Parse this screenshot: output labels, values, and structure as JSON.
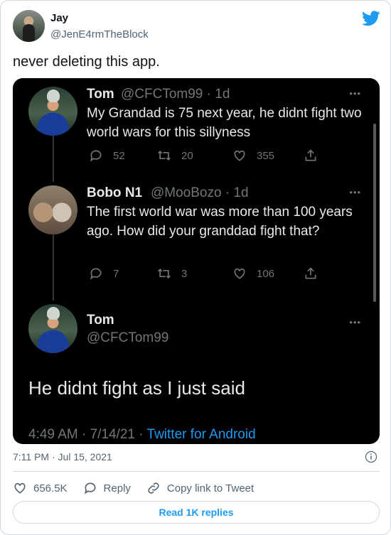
{
  "author": {
    "name": "Jay",
    "handle": "@JenE4rmTheBlock"
  },
  "tweet": {
    "text": "never deleting this app.",
    "timestamp": "7:11 PM · Jul 15, 2021",
    "likes": "656.5K",
    "reply_label": "Reply",
    "copy_link_label": "Copy link to Tweet",
    "read_replies_label": "Read 1K replies"
  },
  "screenshot": {
    "tweets": [
      {
        "name": "Tom",
        "handle": "@CFCTom99",
        "time": "· 1d",
        "text": "My Grandad is 75 next year,  he didnt fight two world wars for this sillyness",
        "replies": "52",
        "retweets": "20",
        "likes": "355"
      },
      {
        "name": "Bobo N1",
        "handle": "@MooBozo",
        "time": "· 1d",
        "text": "The first world war was more than 100 years ago. How did your granddad fight that?",
        "replies": "7",
        "retweets": "3",
        "likes": "106"
      }
    ],
    "main": {
      "name": "Tom",
      "handle": "@CFCTom99",
      "text": "He didnt fight as I just said",
      "time": "4:49 AM · 7/14/21 · ",
      "source": "Twitter for Android"
    },
    "more": "•••"
  },
  "colors": {
    "accent": "#1d9bf0",
    "dark_bg": "#000000"
  },
  "icons": [
    "twitter-bird-icon",
    "reply-icon",
    "retweet-icon",
    "like-icon",
    "share-icon",
    "info-icon",
    "link-icon",
    "more-icon"
  ]
}
